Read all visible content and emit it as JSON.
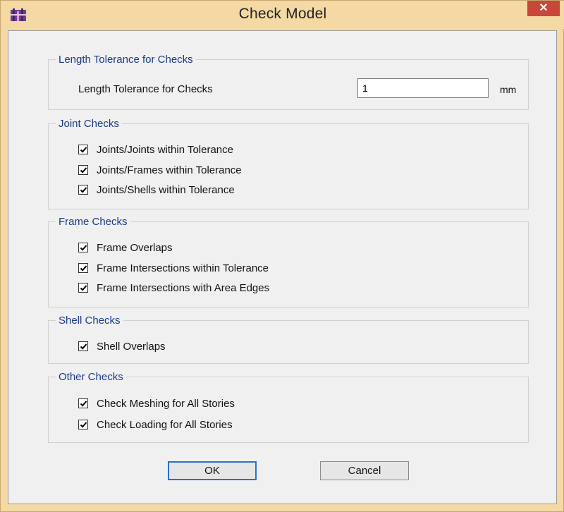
{
  "window": {
    "title": "Check Model",
    "close_symbol": "✕",
    "app_icon": "etabs-app-icon"
  },
  "length_group": {
    "legend": "Length Tolerance for Checks",
    "field_label": "Length Tolerance for Checks",
    "value": "1",
    "unit": "mm"
  },
  "joint_group": {
    "legend": "Joint Checks",
    "items": [
      {
        "label": "Joints/Joints within Tolerance",
        "checked": true
      },
      {
        "label": "Joints/Frames within Tolerance",
        "checked": true
      },
      {
        "label": "Joints/Shells within Tolerance",
        "checked": true
      }
    ]
  },
  "frame_group": {
    "legend": "Frame Checks",
    "items": [
      {
        "label": "Frame Overlaps",
        "checked": true
      },
      {
        "label": "Frame Intersections within Tolerance",
        "checked": true
      },
      {
        "label": "Frame Intersections with Area Edges",
        "checked": true
      }
    ]
  },
  "shell_group": {
    "legend": "Shell Checks",
    "items": [
      {
        "label": "Shell Overlaps",
        "checked": true
      }
    ]
  },
  "other_group": {
    "legend": "Other Checks",
    "items": [
      {
        "label": "Check Meshing for All Stories",
        "checked": true
      },
      {
        "label": "Check Loading for All Stories",
        "checked": true
      }
    ]
  },
  "buttons": {
    "ok": "OK",
    "cancel": "Cancel"
  }
}
